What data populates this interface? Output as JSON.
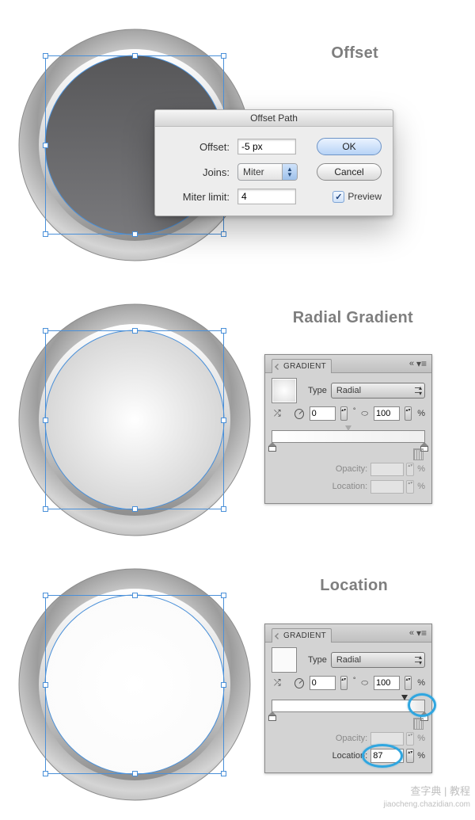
{
  "watermark_main": "查字典 | 教程",
  "watermark_sub": "jiaocheng.chazidian.com",
  "step1": {
    "title": "Offset",
    "dialog": {
      "title": "Offset Path",
      "offset_label": "Offset:",
      "offset_value": "-5 px",
      "joins_label": "Joins:",
      "joins_value": "Miter",
      "miter_label": "Miter limit:",
      "miter_value": "4",
      "ok": "OK",
      "cancel": "Cancel",
      "preview_label": "Preview",
      "preview_checked": "✓"
    }
  },
  "step2": {
    "title": "Radial Gradient",
    "panel": {
      "tab": "GRADIENT",
      "type_label": "Type",
      "type_value": "Radial",
      "angle_value": "0",
      "ar_value": "100",
      "percent": "%",
      "opacity_label": "Opacity:",
      "location_label": "Location:"
    }
  },
  "step3": {
    "title": "Location",
    "panel": {
      "tab": "GRADIENT",
      "type_label": "Type",
      "type_value": "Radial",
      "angle_value": "0",
      "ar_value": "100",
      "percent": "%",
      "opacity_label": "Opacity:",
      "location_label": "Location:",
      "location_value": "87"
    }
  }
}
